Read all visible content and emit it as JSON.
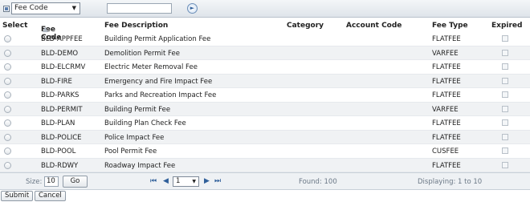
{
  "filter": {
    "field_label": "Fee Code",
    "search_value": ""
  },
  "columns": [
    "Select",
    "Fee Code",
    "Fee Description",
    "Category",
    "Account Code",
    "Fee Type",
    "Expired"
  ],
  "rows": [
    {
      "code": "BLD-APPFEE",
      "desc": "Building Permit Application Fee",
      "category": "",
      "account": "",
      "type": "FLATFEE"
    },
    {
      "code": "BLD-DEMO",
      "desc": "Demolition Permit Fee",
      "category": "",
      "account": "",
      "type": "VARFEE"
    },
    {
      "code": "BLD-ELCRMV",
      "desc": "Electric Meter Removal Fee",
      "category": "",
      "account": "",
      "type": "FLATFEE"
    },
    {
      "code": "BLD-FIRE",
      "desc": "Emergency and Fire Impact Fee",
      "category": "",
      "account": "",
      "type": "FLATFEE"
    },
    {
      "code": "BLD-PARKS",
      "desc": "Parks and Recreation Impact Fee",
      "category": "",
      "account": "",
      "type": "FLATFEE"
    },
    {
      "code": "BLD-PERMIT",
      "desc": "Building Permit Fee",
      "category": "",
      "account": "",
      "type": "VARFEE"
    },
    {
      "code": "BLD-PLAN",
      "desc": "Building Plan Check Fee",
      "category": "",
      "account": "",
      "type": "FLATFEE"
    },
    {
      "code": "BLD-POLICE",
      "desc": "Police Impact Fee",
      "category": "",
      "account": "",
      "type": "FLATFEE"
    },
    {
      "code": "BLD-POOL",
      "desc": "Pool Permit Fee",
      "category": "",
      "account": "",
      "type": "CUSFEE"
    },
    {
      "code": "BLD-RDWY",
      "desc": "Roadway Impact Fee",
      "category": "",
      "account": "",
      "type": "FLATFEE"
    }
  ],
  "pager": {
    "size_label": "Size:",
    "size_value": "10",
    "go_label": "Go",
    "page_value": "1",
    "found_text": "Found: 100",
    "displaying_text": "Displaying: 1 to 10"
  },
  "actions": {
    "submit_label": "Submit",
    "cancel_label": "Cancel"
  },
  "colors": {
    "accent": "#2f5f9a",
    "alt_row": "#f0f2f4",
    "pager_bg": "#eef1f4"
  }
}
